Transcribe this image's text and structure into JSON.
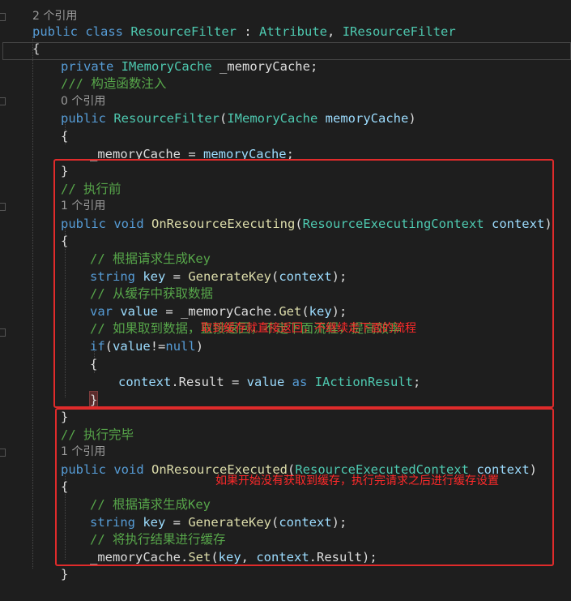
{
  "lines": {
    "l0": "2 个引用",
    "l1_public": "public",
    "l1_class": "class",
    "l1_name": "ResourceFilter",
    "l1_colon": " : ",
    "l1_attr": "Attribute",
    "l1_comma": ", ",
    "l1_iface": "IResourceFilter",
    "l2": "{",
    "l3_private": "private",
    "l3_type": "IMemoryCache",
    "l3_field": " _memoryCache;",
    "l4": "/// 构造函数注入",
    "l5": "0 个引用",
    "l6_public": "public",
    "l6_ctor": "ResourceFilter",
    "l6_open": "(",
    "l6_type": "IMemoryCache",
    "l6_param": "memoryCache",
    "l6_close": ")",
    "l7": "{",
    "l8_field": "_memoryCache",
    "l8_eq": " = ",
    "l8_param": "memoryCache",
    "l8_end": ";",
    "l9": "}",
    "l10": "// 执行前",
    "l11": "1 个引用",
    "l12_public": "public",
    "l12_void": "void",
    "l12_method": "OnResourceExecuting",
    "l12_open": "(",
    "l12_type": "ResourceExecutingContext",
    "l12_param": "context",
    "l12_close": ")",
    "l13": "{",
    "l14": "// 根据请求生成Key",
    "l15_string": "string",
    "l15_key": "key",
    "l15_eq": " = ",
    "l15_fn": "GenerateKey",
    "l15_open": "(",
    "l15_ctx": "context",
    "l15_close": ");",
    "l16": "// 从缓存中获取数据",
    "l17_var": "var",
    "l17_value": "value",
    "l17_eq": " = _memoryCache.",
    "l17_get": "Get",
    "l17_open": "(",
    "l17_key": "key",
    "l17_close": ");",
    "l18": "// 如果取到数据，直接返回，不走下面流程，提高效率",
    "l19_if": "if",
    "l19_open": "(",
    "l19_value": "value",
    "l19_neq": "!=",
    "l19_null": "null",
    "l19_close": ")",
    "l20": "{",
    "l21_ctx": "context",
    "l21_dot": ".Result = ",
    "l21_value": "value",
    "l21_as": "as",
    "l21_type": "IActionResult",
    "l21_end": ";",
    "l22": "}",
    "l23": "}",
    "l24": "// 执行完毕",
    "l25": "1 个引用",
    "l26_public": "public",
    "l26_void": "void",
    "l26_method": "OnResourceExecuted",
    "l26_open": "(",
    "l26_type": "ResourceExecutedContext",
    "l26_param": "context",
    "l26_close": ")",
    "l27": "{",
    "l28": "// 根据请求生成Key",
    "l29_string": "string",
    "l29_key": "key",
    "l29_eq": " = ",
    "l29_fn": "GenerateKey",
    "l29_open": "(",
    "l29_ctx": "context",
    "l29_close": ");",
    "l30": "// 将执行结果进行缓存",
    "l31_field": "_memoryCache.",
    "l31_set": "Set",
    "l31_open": "(",
    "l31_key": "key",
    "l31_comma": ", ",
    "l31_ctx": "context",
    "l31_close": ".Result);",
    "l32": "}"
  },
  "annotations": {
    "note_cache_hit": "取到缓存就直接返回，不继续走下面的流程",
    "note_cache_set": "如果开始没有获取到缓存，执行完请求之后进行缓存设置"
  },
  "colors": {
    "background": "#1e1e1e",
    "keyword": "#569cd6",
    "type": "#4ec9b0",
    "method": "#dcdcaa",
    "parameter": "#9cdcfe",
    "comment": "#57a64a",
    "annotation_red": "#e02b2b"
  }
}
